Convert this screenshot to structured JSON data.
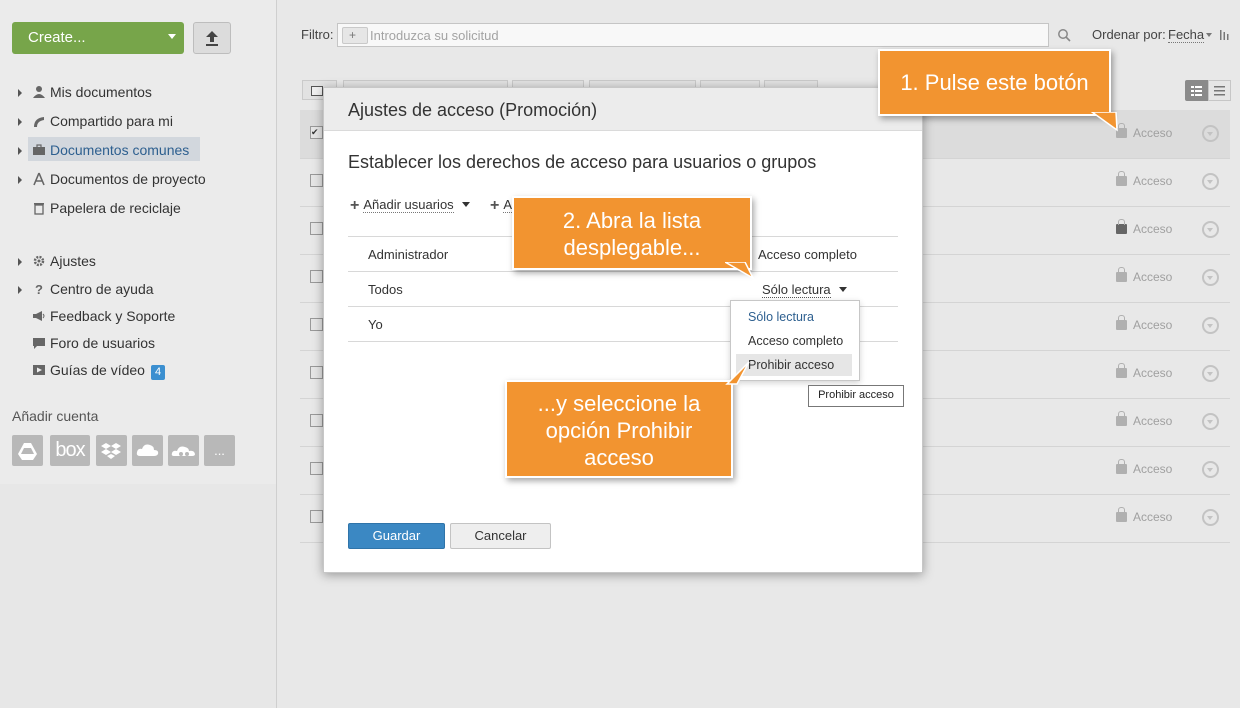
{
  "sidebar": {
    "create_label": "Create...",
    "nav": [
      {
        "label": "Mis documentos",
        "icon": "user-icon"
      },
      {
        "label": "Compartido para mi",
        "icon": "share-icon"
      },
      {
        "label": "Documentos comunes",
        "icon": "briefcase-icon"
      },
      {
        "label": "Documentos de proyecto",
        "icon": "project-icon"
      },
      {
        "label": "Papelera de reciclaje",
        "icon": "trash-icon"
      }
    ],
    "nav2": [
      {
        "label": "Ajustes",
        "icon": "gear-icon"
      },
      {
        "label": "Centro de ayuda",
        "icon": "question-icon"
      },
      {
        "label": "Feedback y Soporte",
        "icon": "megaphone-icon"
      },
      {
        "label": "Foro de usuarios",
        "icon": "speech-bubble-icon"
      },
      {
        "label": "Guías de vídeo",
        "icon": "video-icon",
        "badge": "4"
      }
    ],
    "add_account_label": "Añadir cuenta",
    "accounts": [
      {
        "label": "",
        "icon": "google-drive-icon"
      },
      {
        "label": "box",
        "icon": "box-icon"
      },
      {
        "label": "",
        "icon": "dropbox-icon"
      },
      {
        "label": "",
        "icon": "cloud-icon"
      },
      {
        "label": "",
        "icon": "cloud2-icon"
      },
      {
        "label": "...",
        "icon": "more-icon"
      }
    ]
  },
  "toolbar": {
    "filter_label": "Filtro:",
    "filter_placeholder": "Introduzca su solicitud",
    "sort_label": "Ordenar por:",
    "sort_value": "Fecha"
  },
  "rows": [
    {
      "access": "Acceso",
      "selected": true
    },
    {
      "access": "Acceso",
      "selected": false
    },
    {
      "access": "Acceso",
      "selected": false
    },
    {
      "access": "Acceso",
      "selected": false
    },
    {
      "access": "Acceso",
      "selected": false
    },
    {
      "access": "Acceso",
      "selected": false
    },
    {
      "access": "Acceso",
      "selected": false
    },
    {
      "access": "Acceso",
      "selected": false
    },
    {
      "access": "Acceso",
      "selected": false
    }
  ],
  "dialog": {
    "title": "Ajustes de acceso (Promoción)",
    "heading": "Establecer los derechos de acceso para usuarios o grupos",
    "add_users": "Añadir usuarios",
    "add_groups": "A",
    "permissions": [
      {
        "name": "Administrador",
        "value": "Acceso completo"
      },
      {
        "name": "Todos",
        "value": "Sólo lectura"
      },
      {
        "name": "Yo",
        "value": ""
      }
    ],
    "dropdown_options": [
      "Sólo lectura",
      "Acceso completo",
      "Prohibir acceso"
    ],
    "tooltip": "Prohibir acceso",
    "save": "Guardar",
    "cancel": "Cancelar"
  },
  "callouts": {
    "step1": "1. Pulse este botón",
    "step2_line1": "2. Abra la lista",
    "step2_line2": "desplegable...",
    "step3_line1": "...y seleccione la",
    "step3_line2": "opción Prohibir",
    "step3_line3": "acceso"
  },
  "colors": {
    "accent_green": "#77a54a",
    "callout_orange": "#f29430",
    "primary_blue": "#3b88c3"
  }
}
